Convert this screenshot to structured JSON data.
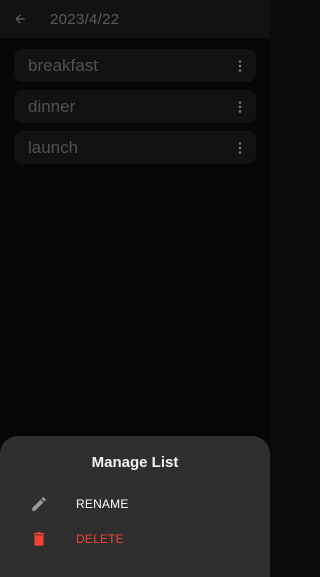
{
  "appbar": {
    "title": "2023/4/22",
    "back_icon": "arrow-left-icon"
  },
  "lists": [
    {
      "label": "breakfast",
      "menu_icon": "more-vert-icon"
    },
    {
      "label": "dinner",
      "menu_icon": "more-vert-icon"
    },
    {
      "label": "launch",
      "menu_icon": "more-vert-icon"
    }
  ],
  "sheet": {
    "title": "Manage List",
    "options": [
      {
        "label": "RENAME",
        "icon": "pencil-icon",
        "color": "#ffffff"
      },
      {
        "label": "DELETE",
        "icon": "trash-icon",
        "color": "#f44336"
      }
    ]
  },
  "colors": {
    "background": "#0b0b0b",
    "surface": "#1c1c1c",
    "sheet": "#2f2f2f",
    "danger": "#f44336"
  }
}
